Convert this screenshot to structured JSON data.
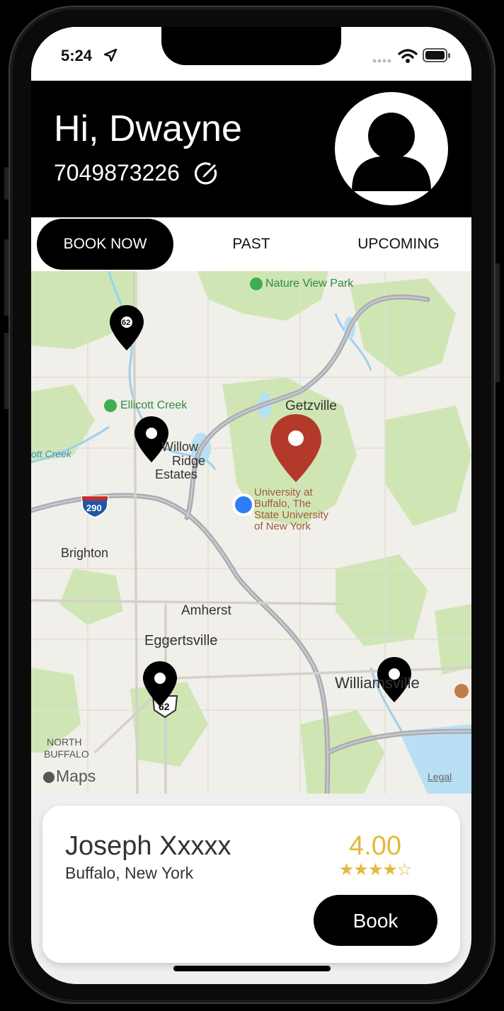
{
  "status_bar": {
    "time": "5:24"
  },
  "header": {
    "greeting": "Hi, Dwayne",
    "phone": "7049873226"
  },
  "tabs": [
    {
      "label": "BOOK NOW",
      "active": true
    },
    {
      "label": "PAST",
      "active": false
    },
    {
      "label": "UPCOMING",
      "active": false
    }
  ],
  "map": {
    "labels": {
      "nature_view_park": "Nature View Park",
      "ellicott_creek": "Ellicott Creek",
      "getzville": "Getzville",
      "willow_ridge": "Willow",
      "ridge": "Ridge",
      "estates": "Estates",
      "university": "University at",
      "university2": "Buffalo, The",
      "university3": "State University",
      "university4": "of New York",
      "brighton": "Brighton",
      "amherst": "Amherst",
      "eggertsville": "Eggertsville",
      "williamsville": "Williamsville",
      "north": "NORTH",
      "buffalo": "BUFFALO",
      "creek": "ott Creek",
      "interstate": "290",
      "route_62": "62",
      "route_62_top": "62",
      "maps_brand": "Maps",
      "legal": "Legal"
    },
    "colors": {
      "selected_pin": "#b3392b",
      "pin": "#000000",
      "user_location": "#2f7cf6"
    }
  },
  "provider_card": {
    "name": "Joseph Xxxxx",
    "location": "Buffalo, New York",
    "rating": "4.00",
    "stars": "★★★★☆",
    "book_label": "Book"
  }
}
